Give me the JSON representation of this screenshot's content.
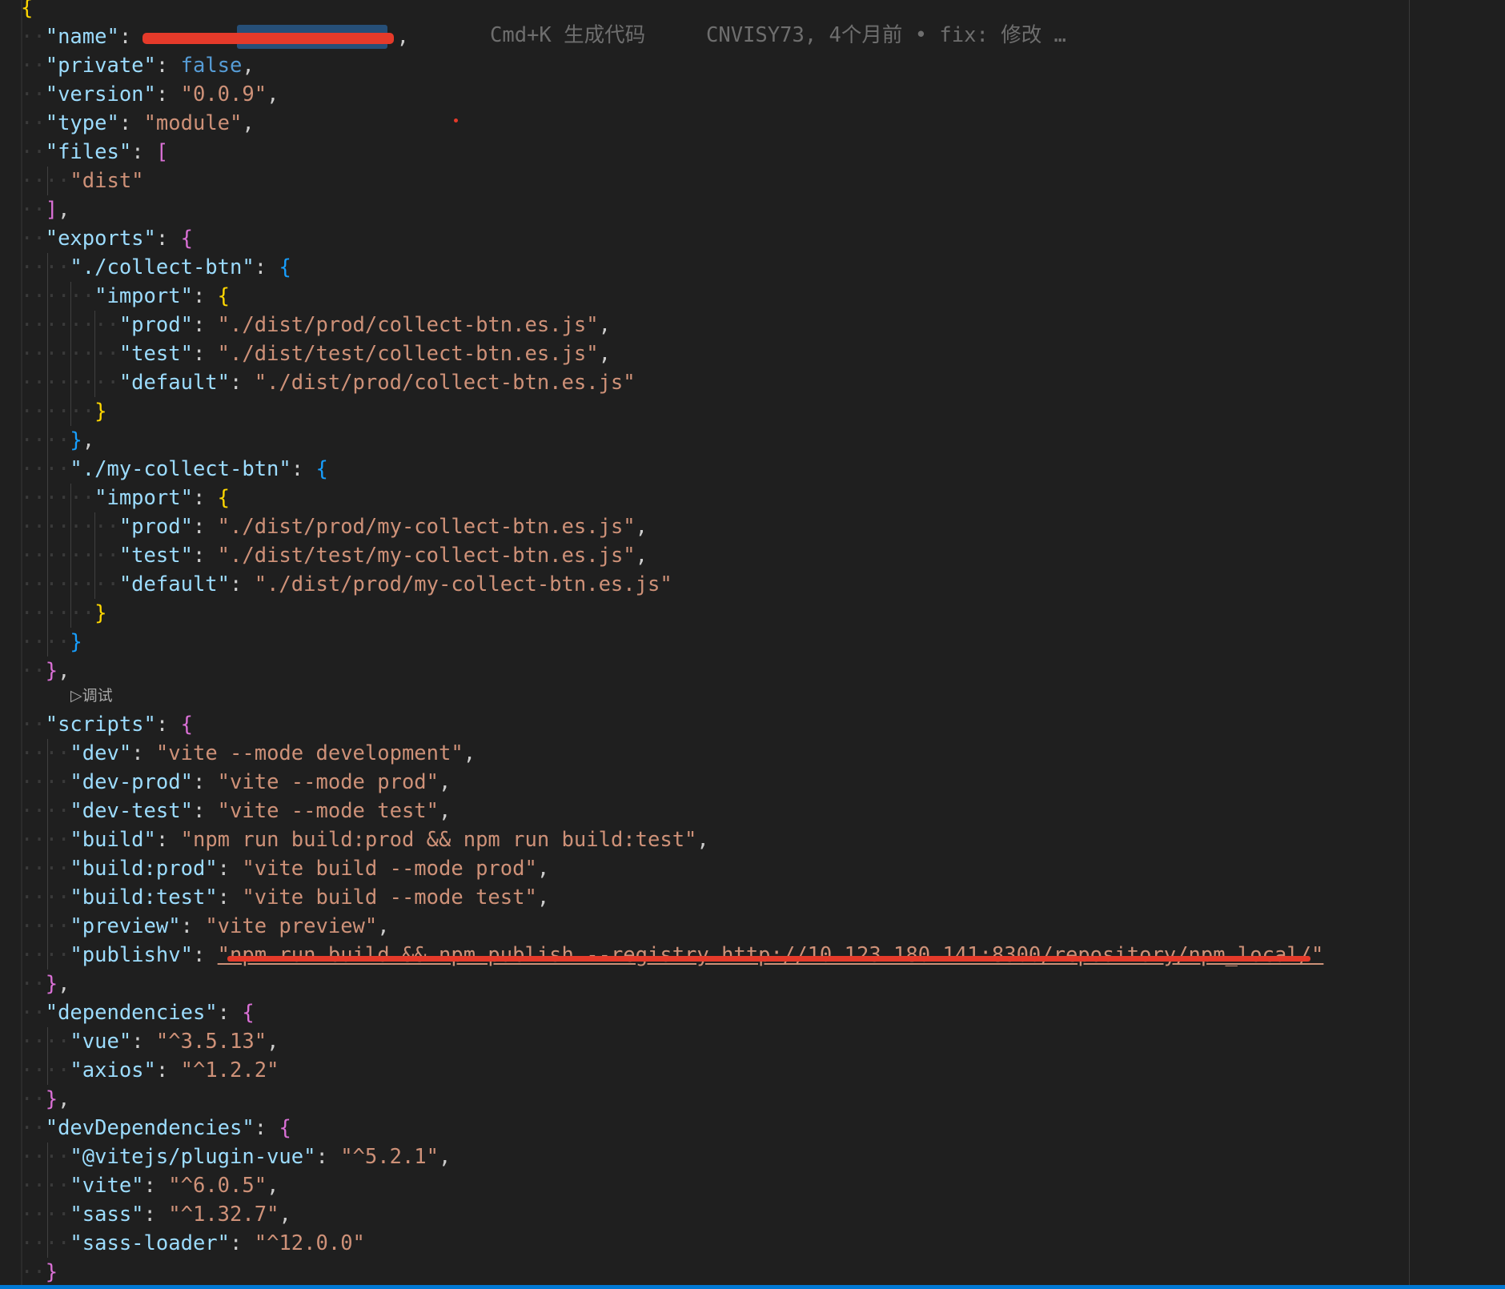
{
  "editor": {
    "file_content_lines": [
      [
        {
          "t": "{",
          "c": "b1"
        }
      ],
      [
        {
          "t": "\"name\"",
          "c": "key"
        },
        {
          "t": ": ",
          "c": "punc"
        },
        {
          "t": "\"[redacted]\"",
          "c": "str",
          "redacted": true
        },
        {
          "t": ",",
          "c": "punc"
        }
      ],
      [
        {
          "t": "\"private\"",
          "c": "key"
        },
        {
          "t": ": ",
          "c": "punc"
        },
        {
          "t": "false",
          "c": "bool"
        },
        {
          "t": ",",
          "c": "punc"
        }
      ],
      [
        {
          "t": "\"version\"",
          "c": "key"
        },
        {
          "t": ": ",
          "c": "punc"
        },
        {
          "t": "\"0.0.9\"",
          "c": "str"
        },
        {
          "t": ",",
          "c": "punc"
        }
      ],
      [
        {
          "t": "\"type\"",
          "c": "key"
        },
        {
          "t": ": ",
          "c": "punc"
        },
        {
          "t": "\"module\"",
          "c": "str"
        },
        {
          "t": ",",
          "c": "punc"
        }
      ],
      [
        {
          "t": "\"files\"",
          "c": "key"
        },
        {
          "t": ": ",
          "c": "punc"
        },
        {
          "t": "[",
          "c": "b2"
        }
      ],
      [
        {
          "t": "\"dist\"",
          "c": "str"
        }
      ],
      [
        {
          "t": "]",
          "c": "b2"
        },
        {
          "t": ",",
          "c": "punc"
        }
      ],
      [
        {
          "t": "\"exports\"",
          "c": "key"
        },
        {
          "t": ": ",
          "c": "punc"
        },
        {
          "t": "{",
          "c": "b2"
        }
      ],
      [
        {
          "t": "\"./collect-btn\"",
          "c": "key"
        },
        {
          "t": ": ",
          "c": "punc"
        },
        {
          "t": "{",
          "c": "b3"
        }
      ],
      [
        {
          "t": "\"import\"",
          "c": "key"
        },
        {
          "t": ": ",
          "c": "punc"
        },
        {
          "t": "{",
          "c": "b1"
        }
      ],
      [
        {
          "t": "\"prod\"",
          "c": "key"
        },
        {
          "t": ": ",
          "c": "punc"
        },
        {
          "t": "\"./dist/prod/collect-btn.es.js\"",
          "c": "str"
        },
        {
          "t": ",",
          "c": "punc"
        }
      ],
      [
        {
          "t": "\"test\"",
          "c": "key"
        },
        {
          "t": ": ",
          "c": "punc"
        },
        {
          "t": "\"./dist/test/collect-btn.es.js\"",
          "c": "str"
        },
        {
          "t": ",",
          "c": "punc"
        }
      ],
      [
        {
          "t": "\"default\"",
          "c": "key"
        },
        {
          "t": ": ",
          "c": "punc"
        },
        {
          "t": "\"./dist/prod/collect-btn.es.js\"",
          "c": "str"
        }
      ],
      [
        {
          "t": "}",
          "c": "b1"
        }
      ],
      [
        {
          "t": "}",
          "c": "b3"
        },
        {
          "t": ",",
          "c": "punc"
        }
      ],
      [
        {
          "t": "\"./my-collect-btn\"",
          "c": "key"
        },
        {
          "t": ": ",
          "c": "punc"
        },
        {
          "t": "{",
          "c": "b3"
        }
      ],
      [
        {
          "t": "\"import\"",
          "c": "key"
        },
        {
          "t": ": ",
          "c": "punc"
        },
        {
          "t": "{",
          "c": "b1"
        }
      ],
      [
        {
          "t": "\"prod\"",
          "c": "key"
        },
        {
          "t": ": ",
          "c": "punc"
        },
        {
          "t": "\"./dist/prod/my-collect-btn.es.js\"",
          "c": "str"
        },
        {
          "t": ",",
          "c": "punc"
        }
      ],
      [
        {
          "t": "\"test\"",
          "c": "key"
        },
        {
          "t": ": ",
          "c": "punc"
        },
        {
          "t": "\"./dist/test/my-collect-btn.es.js\"",
          "c": "str"
        },
        {
          "t": ",",
          "c": "punc"
        }
      ],
      [
        {
          "t": "\"default\"",
          "c": "key"
        },
        {
          "t": ": ",
          "c": "punc"
        },
        {
          "t": "\"./dist/prod/my-collect-btn.es.js\"",
          "c": "str"
        }
      ],
      [
        {
          "t": "}",
          "c": "b1"
        }
      ],
      [
        {
          "t": "}",
          "c": "b3"
        }
      ],
      [
        {
          "t": "}",
          "c": "b2"
        },
        {
          "t": ",",
          "c": "punc"
        }
      ],
      [
        {
          "t": "\"scripts\"",
          "c": "key"
        },
        {
          "t": ": ",
          "c": "punc"
        },
        {
          "t": "{",
          "c": "b2"
        }
      ],
      [
        {
          "t": "\"dev\"",
          "c": "key"
        },
        {
          "t": ": ",
          "c": "punc"
        },
        {
          "t": "\"vite --mode development\"",
          "c": "str"
        },
        {
          "t": ",",
          "c": "punc"
        }
      ],
      [
        {
          "t": "\"dev-prod\"",
          "c": "key"
        },
        {
          "t": ": ",
          "c": "punc"
        },
        {
          "t": "\"vite --mode prod\"",
          "c": "str"
        },
        {
          "t": ",",
          "c": "punc"
        }
      ],
      [
        {
          "t": "\"dev-test\"",
          "c": "key"
        },
        {
          "t": ": ",
          "c": "punc"
        },
        {
          "t": "\"vite --mode test\"",
          "c": "str"
        },
        {
          "t": ",",
          "c": "punc"
        }
      ],
      [
        {
          "t": "\"build\"",
          "c": "key"
        },
        {
          "t": ": ",
          "c": "punc"
        },
        {
          "t": "\"npm run build:prod && npm run build:test\"",
          "c": "str"
        },
        {
          "t": ",",
          "c": "punc"
        }
      ],
      [
        {
          "t": "\"build:prod\"",
          "c": "key"
        },
        {
          "t": ": ",
          "c": "punc"
        },
        {
          "t": "\"vite build --mode prod\"",
          "c": "str"
        },
        {
          "t": ",",
          "c": "punc"
        }
      ],
      [
        {
          "t": "\"build:test\"",
          "c": "key"
        },
        {
          "t": ": ",
          "c": "punc"
        },
        {
          "t": "\"vite build --mode test\"",
          "c": "str"
        },
        {
          "t": ",",
          "c": "punc"
        }
      ],
      [
        {
          "t": "\"preview\"",
          "c": "key"
        },
        {
          "t": ": ",
          "c": "punc"
        },
        {
          "t": "\"vite preview\"",
          "c": "str"
        },
        {
          "t": ",",
          "c": "punc"
        }
      ],
      [
        {
          "t": "\"publishv\"",
          "c": "key"
        },
        {
          "t": ": ",
          "c": "punc"
        },
        {
          "t": "\"npm run build && npm publish --registry http://10.123.180.141:8300/repository/npm_local/\"",
          "c": "str",
          "redacted_strike": true
        }
      ],
      [
        {
          "t": "}",
          "c": "b2"
        },
        {
          "t": ",",
          "c": "punc"
        }
      ],
      [
        {
          "t": "\"dependencies\"",
          "c": "key"
        },
        {
          "t": ": ",
          "c": "punc"
        },
        {
          "t": "{",
          "c": "b2"
        }
      ],
      [
        {
          "t": "\"vue\"",
          "c": "key"
        },
        {
          "t": ": ",
          "c": "punc"
        },
        {
          "t": "\"^3.5.13\"",
          "c": "str"
        },
        {
          "t": ",",
          "c": "punc"
        }
      ],
      [
        {
          "t": "\"axios\"",
          "c": "key"
        },
        {
          "t": ": ",
          "c": "punc"
        },
        {
          "t": "\"^1.2.2\"",
          "c": "str"
        }
      ],
      [
        {
          "t": "}",
          "c": "b2"
        },
        {
          "t": ",",
          "c": "punc"
        }
      ],
      [
        {
          "t": "\"devDependencies\"",
          "c": "key"
        },
        {
          "t": ": ",
          "c": "punc"
        },
        {
          "t": "{",
          "c": "b2"
        }
      ],
      [
        {
          "t": "\"@vitejs/plugin-vue\"",
          "c": "key"
        },
        {
          "t": ": ",
          "c": "punc"
        },
        {
          "t": "\"^5.2.1\"",
          "c": "str"
        },
        {
          "t": ",",
          "c": "punc"
        }
      ],
      [
        {
          "t": "\"vite\"",
          "c": "key"
        },
        {
          "t": ": ",
          "c": "punc"
        },
        {
          "t": "\"^6.0.5\"",
          "c": "str"
        },
        {
          "t": ",",
          "c": "punc"
        }
      ],
      [
        {
          "t": "\"sass\"",
          "c": "key"
        },
        {
          "t": ": ",
          "c": "punc"
        },
        {
          "t": "\"^1.32.7\"",
          "c": "str"
        },
        {
          "t": ",",
          "c": "punc"
        }
      ],
      [
        {
          "t": "\"sass-loader\"",
          "c": "key"
        },
        {
          "t": ": ",
          "c": "punc"
        },
        {
          "t": "\"^12.0.0\"",
          "c": "str"
        }
      ],
      [
        {
          "t": "}",
          "c": "b2"
        }
      ]
    ],
    "indent_levels": [
      0,
      1,
      1,
      1,
      1,
      1,
      2,
      1,
      1,
      2,
      3,
      4,
      4,
      4,
      3,
      2,
      2,
      3,
      4,
      4,
      4,
      3,
      2,
      1,
      1,
      2,
      2,
      2,
      2,
      2,
      2,
      2,
      2,
      1,
      1,
      2,
      2,
      1,
      1,
      2,
      2,
      2,
      2,
      1
    ],
    "inline_hints": {
      "cmd_k": "Cmd+K 生成代码",
      "git_blame": "CNVISY73, 4个月前 • fix: 修改 …"
    },
    "codelens": {
      "label": "调试",
      "icon": "play-triangle-icon"
    },
    "colors": {
      "background": "#1f1f1f",
      "key": "#9cdcfe",
      "string": "#ce9178",
      "boolean": "#569cd6",
      "bracket_level_1": "#ffd700",
      "bracket_level_2": "#da70d6",
      "bracket_level_3": "#179fff",
      "redaction": "#e53a2a",
      "status_bar": "#0078d4"
    }
  }
}
